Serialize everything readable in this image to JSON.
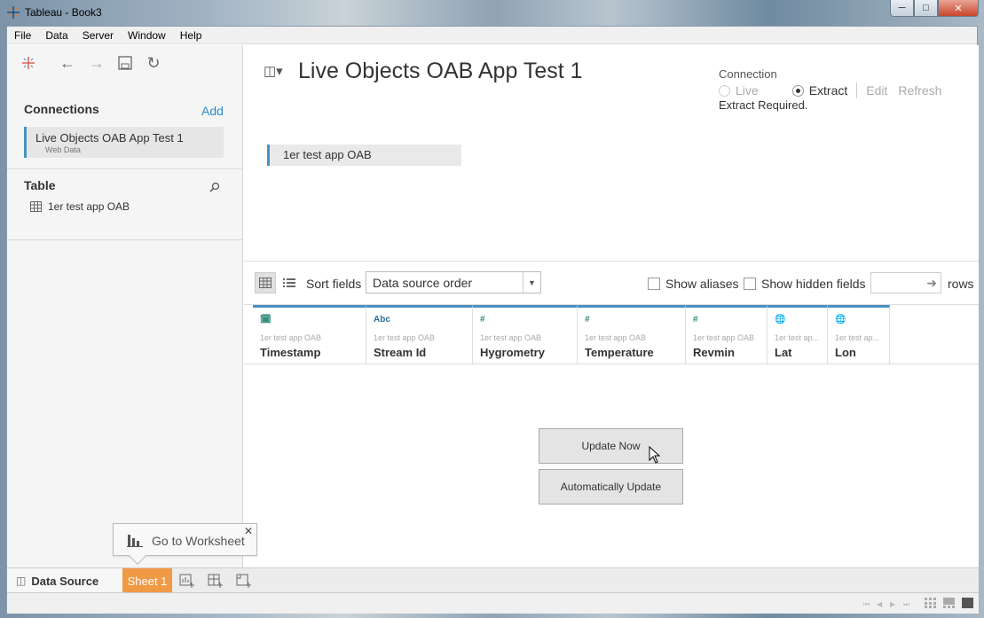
{
  "window": {
    "title": "Tableau - Book3"
  },
  "menu": [
    "File",
    "Data",
    "Server",
    "Window",
    "Help"
  ],
  "left": {
    "connections_title": "Connections",
    "add_label": "Add",
    "connection": {
      "name": "Live Objects OAB App Test 1",
      "type": "Web Data"
    },
    "table_title": "Table",
    "table_item": "1er test app OAB"
  },
  "main": {
    "title": "Live Objects OAB App Test 1",
    "connection_label": "Connection",
    "live_label": "Live",
    "extract_label": "Extract",
    "edit_label": "Edit",
    "refresh_label": "Refresh",
    "extract_required": "Extract Required.",
    "canvas_table": "1er test app OAB"
  },
  "grid": {
    "sort_label": "Sort fields",
    "sort_value": "Data source order",
    "show_aliases": "Show aliases",
    "show_hidden": "Show hidden fields",
    "rows_label": "rows",
    "columns": [
      {
        "type_icon": "calendar",
        "source": "1er test app OAB",
        "name": "Timestamp"
      },
      {
        "type_icon": "Abc",
        "source": "1er test app OAB",
        "name": "Stream Id"
      },
      {
        "type_icon": "#",
        "source": "1er test app OAB",
        "name": "Hygrometry"
      },
      {
        "type_icon": "#",
        "source": "1er test app OAB",
        "name": "Temperature"
      },
      {
        "type_icon": "#",
        "source": "1er test app OAB",
        "name": "Revmin"
      },
      {
        "type_icon": "globe",
        "source": "1er test ap...",
        "name": "Lat"
      },
      {
        "type_icon": "globe",
        "source": "1er test ap...",
        "name": "Lon"
      }
    ],
    "update_now": "Update Now",
    "auto_update": "Automatically Update"
  },
  "bottom": {
    "data_source_tab": "Data Source",
    "sheet_tab": "Sheet 1",
    "tooltip": "Go to Worksheet"
  },
  "colors": {
    "accent": "#4a90c2",
    "sheet_tab": "#f09a45",
    "link": "#2d8ac7"
  }
}
